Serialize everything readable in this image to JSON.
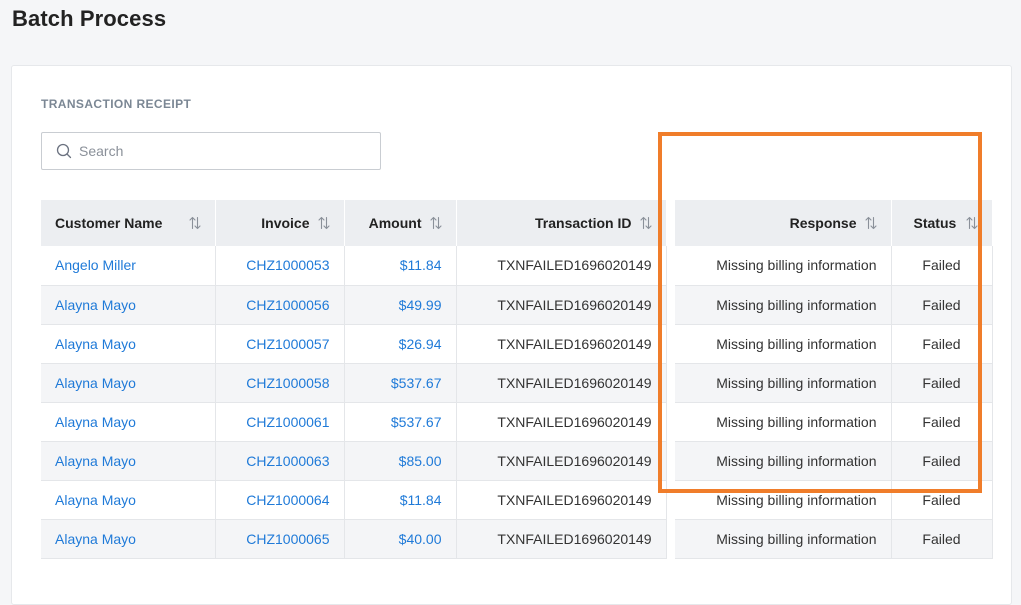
{
  "page": {
    "title": "Batch Process"
  },
  "section": {
    "label": "TRANSACTION RECEIPT"
  },
  "search": {
    "placeholder": "Search",
    "value": ""
  },
  "table": {
    "columns": [
      "Customer Name",
      "Invoice",
      "Amount",
      "Transaction ID",
      "Response",
      "Status"
    ],
    "rows": [
      [
        "Angelo Miller",
        "CHZ1000053",
        "$11.84",
        "TXNFAILED1696020149",
        "Missing billing information",
        "Failed"
      ],
      [
        "Alayna Mayo",
        "CHZ1000056",
        "$49.99",
        "TXNFAILED1696020149",
        "Missing billing information",
        "Failed"
      ],
      [
        "Alayna Mayo",
        "CHZ1000057",
        "$26.94",
        "TXNFAILED1696020149",
        "Missing billing information",
        "Failed"
      ],
      [
        "Alayna Mayo",
        "CHZ1000058",
        "$537.67",
        "TXNFAILED1696020149",
        "Missing billing information",
        "Failed"
      ],
      [
        "Alayna Mayo",
        "CHZ1000061",
        "$537.67",
        "TXNFAILED1696020149",
        "Missing billing information",
        "Failed"
      ],
      [
        "Alayna Mayo",
        "CHZ1000063",
        "$85.00",
        "TXNFAILED1696020149",
        "Missing billing information",
        "Failed"
      ],
      [
        "Alayna Mayo",
        "CHZ1000064",
        "$11.84",
        "TXNFAILED1696020149",
        "Missing billing information",
        "Failed"
      ],
      [
        "Alayna Mayo",
        "CHZ1000065",
        "$40.00",
        "TXNFAILED1696020149",
        "Missing billing information",
        "Failed"
      ]
    ]
  },
  "colors": {
    "link": "#1f7ad8",
    "highlight": "#f07d2a",
    "header_bg": "#eceef1"
  },
  "icons": {
    "search": "search-icon",
    "sort": "sort-icon"
  }
}
